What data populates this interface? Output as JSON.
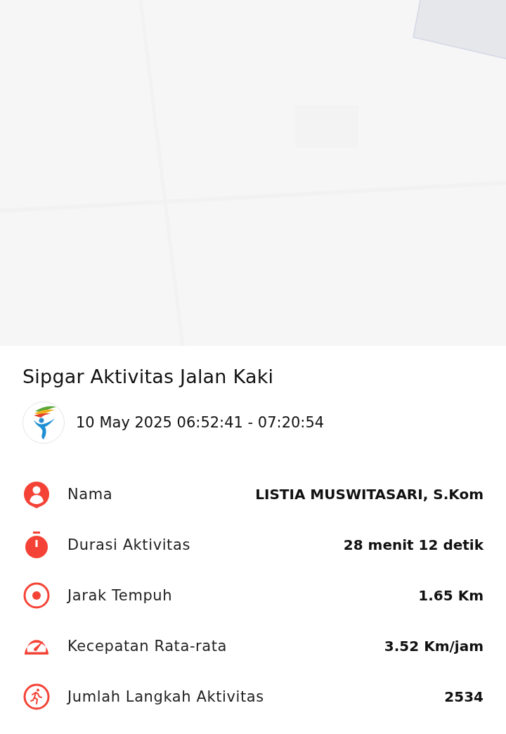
{
  "title": "Sipgar Aktivitas Jalan Kaki",
  "datetime": "10 May 2025 06:52:41 - 07:20:54",
  "stats": [
    {
      "kind": "person",
      "label": "Nama",
      "value": "LISTIA MUSWITASARI, S.Kom"
    },
    {
      "kind": "stopwatch",
      "label": "Durasi Aktivitas",
      "value": "28 menit 12 detik"
    },
    {
      "kind": "target",
      "label": "Jarak Tempuh",
      "value": "1.65 Km"
    },
    {
      "kind": "speed",
      "label": "Kecepatan Rata-rata",
      "value": "3.52 Km/jam"
    },
    {
      "kind": "steps",
      "label": "Jumlah Langkah Aktivitas",
      "value": "2534"
    }
  ]
}
